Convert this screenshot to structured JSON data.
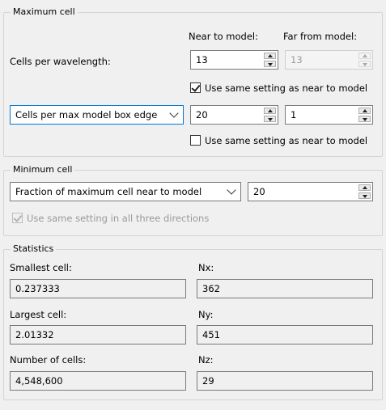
{
  "maximum_cell": {
    "legend": "Maximum cell",
    "near_header": "Near to model:",
    "far_header": "Far from model:",
    "cells_per_wavelength": {
      "label": "Cells per wavelength:",
      "near_value": "13",
      "far_value": "13"
    },
    "use_same_near_1": {
      "label": "Use same setting as near to model",
      "checked": true
    },
    "box_edge": {
      "select": "Cells per max model box edge",
      "near_value": "20",
      "far_value": "1"
    },
    "use_same_near_2": {
      "label": "Use same setting as near to model",
      "checked": false
    }
  },
  "minimum_cell": {
    "legend": "Minimum cell",
    "select": "Fraction of maximum cell near to model",
    "value": "20",
    "same_all": {
      "label": "Use same setting in all three directions",
      "checked": true
    }
  },
  "statistics": {
    "legend": "Statistics",
    "smallest_label": "Smallest cell:",
    "smallest_value": "0.237333",
    "nx_label": "Nx:",
    "nx_value": "362",
    "largest_label": "Largest cell:",
    "largest_value": "2.01332",
    "ny_label": "Ny:",
    "ny_value": "451",
    "count_label": "Number of cells:",
    "count_value": "4,548,600",
    "nz_label": "Nz:",
    "nz_value": "29"
  },
  "icons": [
    "spin-up-icon",
    "spin-down-icon",
    "chevron-down-icon",
    "checkmark-icon"
  ]
}
